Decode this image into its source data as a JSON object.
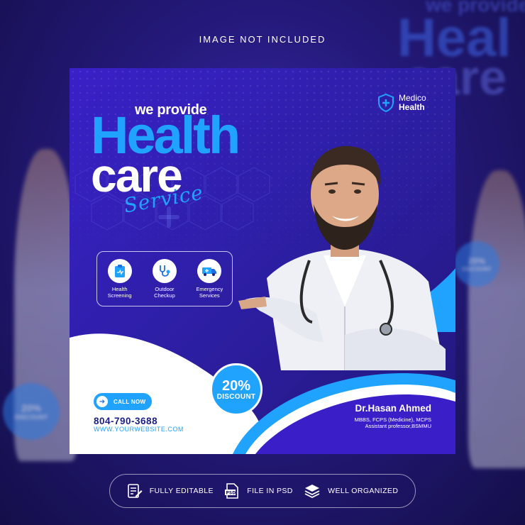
{
  "header": {
    "notice": "IMAGE NOT INCLUDED"
  },
  "background": {
    "word1": "we provide",
    "word2": "Heal",
    "word3": "care",
    "badge_percent": "20%",
    "badge_label": "DISCOUNT",
    "side_percent": "20%",
    "side_label": "DISCOUNT"
  },
  "card": {
    "headline_small": "we provide",
    "headline_health": "Health",
    "headline_care": "care",
    "headline_service": "Service",
    "brand": {
      "line1": "Medico",
      "line2": "Health",
      "icon": "shield-cross-icon"
    },
    "services": [
      {
        "icon": "clipboard-icon",
        "line1": "Health",
        "line2": "Screening"
      },
      {
        "icon": "stethoscope-icon",
        "line1": "Outdoor",
        "line2": "Checkup"
      },
      {
        "icon": "ambulance-icon",
        "line1": "Emergency",
        "line2": "Services"
      }
    ],
    "call_button": {
      "label": "CALL NOW",
      "icon": "arrow-right-icon"
    },
    "phone": "804-790-3688",
    "website": "WWW.YOURWEBSITE.COM",
    "discount": {
      "percent": "20%",
      "label": "DISCOUNT"
    },
    "doctor": {
      "name": "Dr.Hasan Ahmed",
      "cred_line1": "MBBS, FCPS (Medicine), MCPS",
      "cred_line2": "Assistant professor,BSMMU"
    }
  },
  "features": [
    {
      "icon": "edit-document-icon",
      "label": "FULLY EDITABLE"
    },
    {
      "icon": "psd-file-icon",
      "label": "FILE IN PSD"
    },
    {
      "icon": "layers-icon",
      "label": "WELL ORGANIZED"
    }
  ],
  "colors": {
    "accent_blue": "#1fa3ff",
    "card_purple": "#3920c8",
    "dark_navy": "#1a1f8a",
    "page_bg": "#1c1560"
  }
}
